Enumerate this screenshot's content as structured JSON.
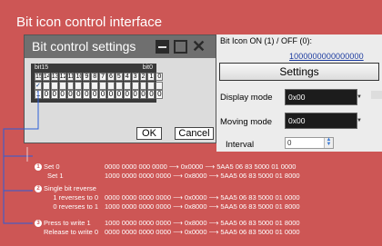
{
  "app_title": "Bit icon control interface",
  "right_panel": {
    "bit_icon_label": "Bit Icon ON (1) / OFF (0):",
    "bit_icon_value": "1000000000000000",
    "settings_label": "Settings",
    "display_mode_label": "Display mode",
    "display_mode_value": "0x00",
    "moving_mode_label": "Moving mode",
    "moving_mode_value": "0x00",
    "interval_label": "Interval",
    "interval_value": "0"
  },
  "dialog": {
    "title": "Bit control settings",
    "bit15_label": "bit15",
    "bit0_label": "bit0",
    "bit_indices": [
      "15",
      "14",
      "13",
      "12",
      "11",
      "10",
      "9",
      "8",
      "7",
      "6",
      "5",
      "4",
      "3",
      "2",
      "1",
      "0"
    ],
    "bit_checks": [
      "✓",
      "",
      "",
      "",
      "",
      "",
      "",
      "",
      "",
      "",
      "",
      "",
      "",
      "",
      "",
      ""
    ],
    "bit_values": [
      "1",
      "0",
      "0",
      "0",
      "0",
      "0",
      "0",
      "0",
      "0",
      "0",
      "0",
      "0",
      "0",
      "0",
      "0",
      "0"
    ],
    "ok_label": "OK",
    "cancel_label": "Cancel"
  },
  "annotations": {
    "set0": "Set 0",
    "set1": "Set 1",
    "single_bit_reverse": "Single bit reverse",
    "reverse_to_0": "1 reverses to 0",
    "reverse_to_1": "0 reverses to 1",
    "press_to_write": "Press to write 1",
    "release_to_write": "Release to write 0",
    "num1": "1",
    "num2": "2",
    "num3": "3",
    "map_set0": "0000  0000 000 0000  ⟶  0x0000  ⟶  5AA5 06 83 5000 01 0000",
    "map_set1": "1000  0000 0000 0000  ⟶  0x8000  ⟶  5AA5 06 83 5000 01 8000",
    "map_rev0": "0000  0000 0000 0000  ⟶  0x0000  ⟶  5AA5 06 83 5000 01 0000",
    "map_rev1": "1000  0000 0000 0000  ⟶  0x8000  ⟶  5AA5 06 83 5000 01 8000",
    "map_press": "1000  0000 0000 0000  ⟶  0x8000  ⟶  5AA5 06 83 5000 01 8000",
    "map_release": "0000  0000 0000 0000  ⟶  0x0000  ⟶  5AA5 06 83 5000 01 0000"
  }
}
